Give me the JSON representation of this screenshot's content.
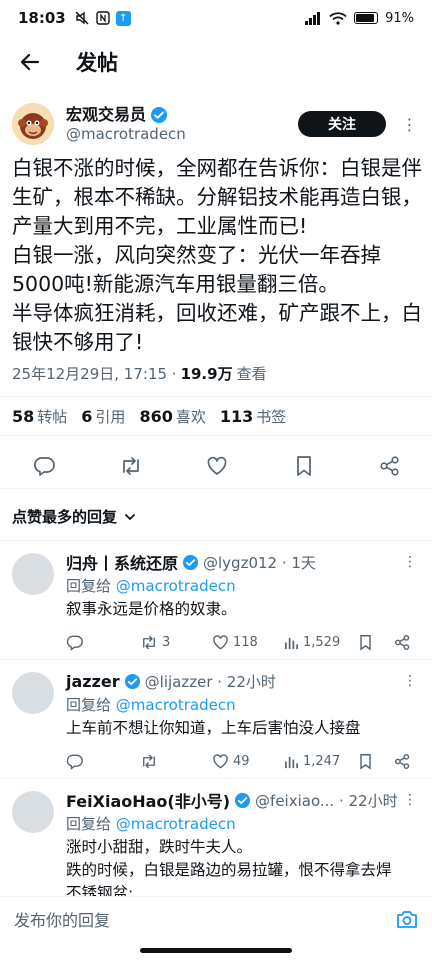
{
  "status_bar": {
    "time": "18:03",
    "battery": "91%"
  },
  "header": {
    "title": "发帖"
  },
  "post": {
    "author_name": "宏观交易员",
    "author_handle": "@macrotradecn",
    "follow_label": "关注",
    "lines": [
      "白银不涨的时候，全网都在告诉你：白银是伴",
      "生矿，根本不稀缺。分解铝技术能再造白银，",
      "产量大到用不完，工业属性而已!",
      "白银一涨，风向突然变了：光伏一年吞掉",
      "5000吨!新能源汽车用银量翻三倍。",
      "半导体疯狂消耗，回收还难，矿产跟不上，白",
      "银快不够用了!"
    ],
    "timestamp": "25年12月29日, 17:15 ·",
    "views": "19.9万",
    "views_suffix": "查看"
  },
  "stats": {
    "reposts_count": "58",
    "reposts_label": "转帖",
    "quotes_count": "6",
    "quotes_label": "引用",
    "likes_count": "860",
    "likes_label": "喜欢",
    "bookmarks_count": "113",
    "bookmarks_label": "书签"
  },
  "sort": {
    "label": "点赞最多的回复"
  },
  "replies": [
    {
      "name": "归舟丨系统还原",
      "handle": "@lygz012 · 1天",
      "reply_to_prefix": "回复给",
      "reply_to": "@macrotradecn",
      "lines": [
        "叙事永远是价格的奴隶。"
      ],
      "retweets": "3",
      "likes": "118",
      "views": "1,529"
    },
    {
      "name": "jazzer",
      "handle": "@lijazzer · 22小时",
      "reply_to_prefix": "回复给",
      "reply_to": "@macrotradecn",
      "lines": [
        "上车前不想让你知道，上车后害怕没人接盘"
      ],
      "retweets": "",
      "likes": "49",
      "views": "1,247"
    },
    {
      "name": "FeiXiaoHao(非小号)",
      "handle": "@feixiao... · 22小时",
      "reply_to_prefix": "回复给",
      "reply_to": "@macrotradecn",
      "lines": [
        "涨时小甜甜，跌时牛夫人。",
        "跌的时候，白银是路边的易拉罐，恨不得拿去焊",
        "不锈钢盆;"
      ],
      "retweets": "",
      "likes": "",
      "views": ""
    }
  ],
  "composer": {
    "placeholder": "发布你的回复"
  }
}
